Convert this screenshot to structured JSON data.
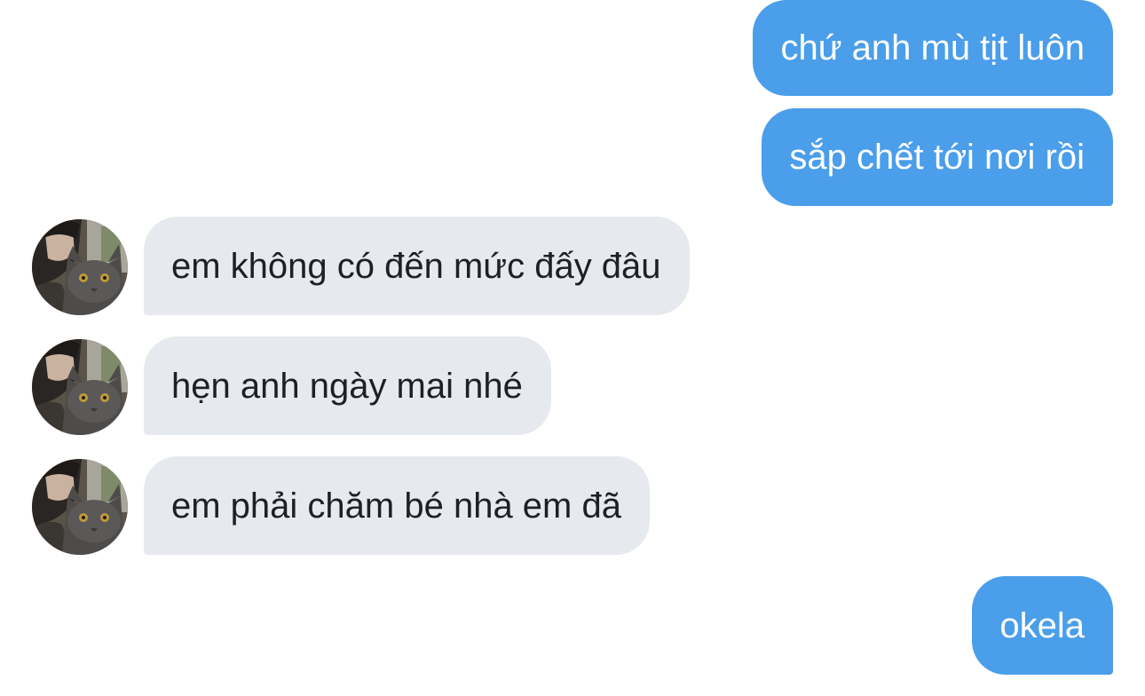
{
  "conversation": {
    "messages": [
      {
        "direction": "outgoing",
        "text": "chứ anh mù tịt luôn"
      },
      {
        "direction": "outgoing",
        "text": "sắp chết tới nơi rồi"
      },
      {
        "direction": "incoming",
        "text": "em không có đến mức đấy đâu",
        "avatar": "avatar-person-with-cat"
      },
      {
        "direction": "incoming",
        "text": "hẹn anh ngày mai nhé",
        "avatar": "avatar-person-with-cat"
      },
      {
        "direction": "incoming",
        "text": "em phải chăm bé nhà em đã",
        "avatar": "avatar-person-with-cat"
      },
      {
        "direction": "outgoing",
        "text": "okela"
      }
    ]
  },
  "colors": {
    "outgoing_bubble": "#4a9eea",
    "incoming_bubble": "#e6e9ed",
    "outgoing_text": "#ffffff",
    "incoming_text": "#1d2126",
    "background": "#ffffff"
  }
}
